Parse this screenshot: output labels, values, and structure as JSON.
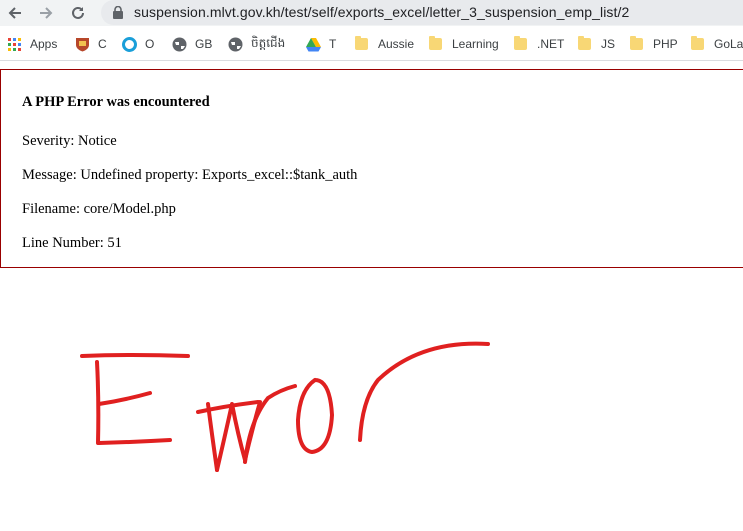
{
  "browser": {
    "url": "suspension.mlvt.gov.kh/test/self/exports_excel/letter_3_suspension_emp_list/2",
    "bookmarks": [
      "Apps",
      "C",
      "O",
      "GB",
      "ចិត្តជើង",
      "T",
      "Aussie",
      "Learning",
      ".NET",
      "JS",
      "PHP",
      "GoLang"
    ]
  },
  "error": {
    "heading": "A PHP Error was encountered",
    "severity": "Severity: Notice",
    "message": "Message: Undefined property: Exports_excel::$tank_auth",
    "filename": "Filename: core/Model.php",
    "line": "Line Number: 51"
  },
  "colors": {
    "error_border": "#990000",
    "scribble": "#e02020"
  }
}
